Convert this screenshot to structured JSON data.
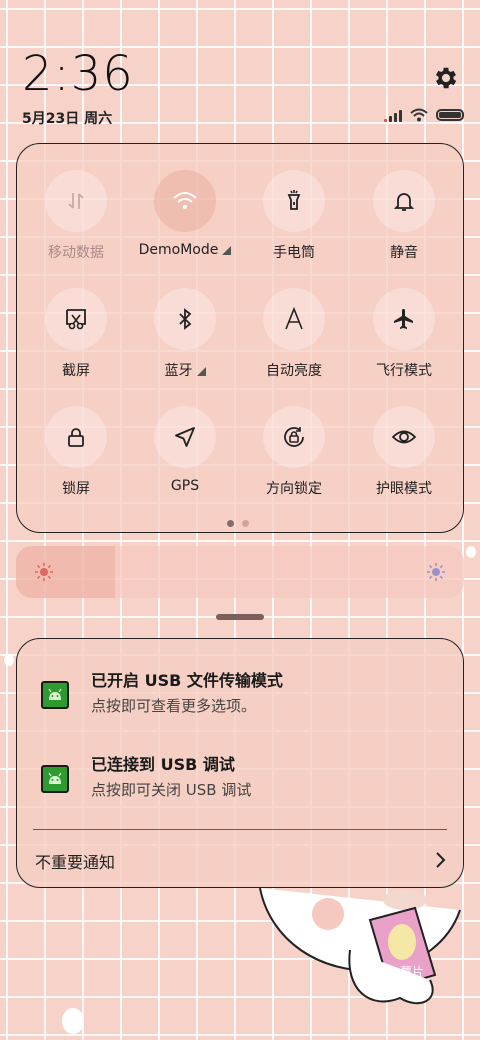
{
  "status": {
    "time": "2:36",
    "date": "5月23日 周六",
    "icons": [
      "gear-icon",
      "signal-icon",
      "wifi-icon",
      "battery-icon"
    ]
  },
  "quick_settings": {
    "tiles": [
      {
        "label": "移动数据",
        "icon": "mobile-data-icon",
        "state": "disabled"
      },
      {
        "label": "DemoMode",
        "icon": "wifi-icon",
        "state": "on",
        "expandable": true
      },
      {
        "label": "手电筒",
        "icon": "flashlight-icon",
        "state": "off"
      },
      {
        "label": "静音",
        "icon": "bell-icon",
        "state": "off"
      },
      {
        "label": "截屏",
        "icon": "screenshot-icon",
        "state": "off"
      },
      {
        "label": "蓝牙",
        "icon": "bluetooth-icon",
        "state": "off",
        "expandable": true
      },
      {
        "label": "自动亮度",
        "icon": "auto-brightness-icon",
        "state": "off"
      },
      {
        "label": "飞行模式",
        "icon": "airplane-icon",
        "state": "off"
      },
      {
        "label": "锁屏",
        "icon": "lock-icon",
        "state": "off"
      },
      {
        "label": "GPS",
        "icon": "location-arrow-icon",
        "state": "off"
      },
      {
        "label": "方向锁定",
        "icon": "rotation-lock-icon",
        "state": "off"
      },
      {
        "label": "护眼模式",
        "icon": "eye-icon",
        "state": "off"
      }
    ],
    "pages": 2,
    "current_page": 1
  },
  "brightness": {
    "level": 0.22
  },
  "notifications": [
    {
      "title": "已开启 USB 文件传输模式",
      "body": "点按即可查看更多选项。",
      "icon": "android-app-icon"
    },
    {
      "title": "已连接到 USB 调试",
      "body": "点按即可关闭 USB 调试",
      "icon": "android-app-icon"
    }
  ],
  "unimportant_label": "不重要通知",
  "colors": {
    "background": "#f6d2c9",
    "panel_border": "#222222",
    "app_icon": "#2f9a2f"
  }
}
